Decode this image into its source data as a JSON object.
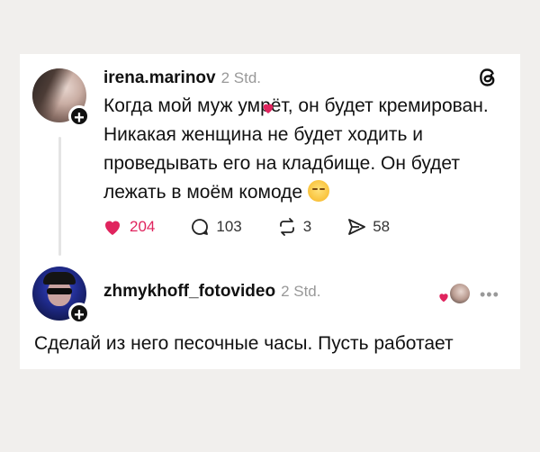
{
  "post": {
    "username": "irena.marinov",
    "time": "2 Std.",
    "text": "Когда мой муж умрёт, он будет кремирован. Никакая женщина не будет ходить и проведывать его на кладбище. Он будет лежать в моём комоде",
    "emoji": "relieved-face",
    "likes": "204",
    "comments": "103",
    "reposts": "3",
    "shares": "58"
  },
  "reply": {
    "username": "zhmykhoff_fotovideo",
    "time": "2 Std.",
    "text": "Сделай из него песочные часы. Пусть работает"
  },
  "icons": {
    "like": "heart-icon",
    "comment": "comment-icon",
    "repost": "repost-icon",
    "share": "send-icon",
    "brand": "threads-icon",
    "more": "more-icon"
  },
  "colors": {
    "like": "#e0245e",
    "text": "#111111",
    "muted": "#999999",
    "background": "#f1efed"
  }
}
